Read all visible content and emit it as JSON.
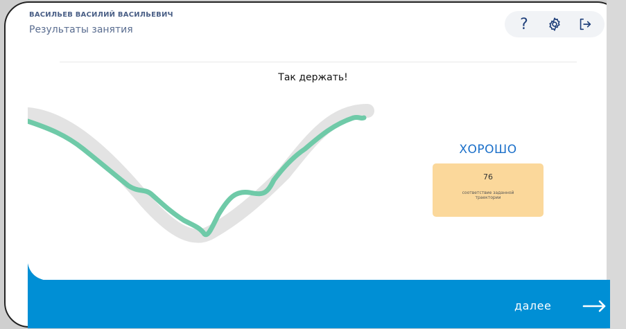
{
  "header": {
    "user_name": "ВАСИЛЬЕВ ВАСИЛИЙ ВАСИЛЬЕВИЧ",
    "page_title": "Результаты занятия"
  },
  "toolbar": {
    "help_label": "?",
    "help_icon": "question-icon",
    "settings_icon": "gear-icon",
    "exit_icon": "logout-icon"
  },
  "feedback": {
    "message": "Так держать!"
  },
  "result": {
    "rating": "ХОРОШО",
    "score": "76",
    "caption": "соответствие заданной траектории"
  },
  "footer": {
    "next_label": "далее",
    "next_icon": "arrow-right-icon"
  },
  "colors": {
    "accent_blue": "#008fd5",
    "rating_blue": "#1a6fc9",
    "card_bg": "#fbd89b",
    "target_path": "#e3e3e3",
    "user_path": "#6fcaa8"
  }
}
